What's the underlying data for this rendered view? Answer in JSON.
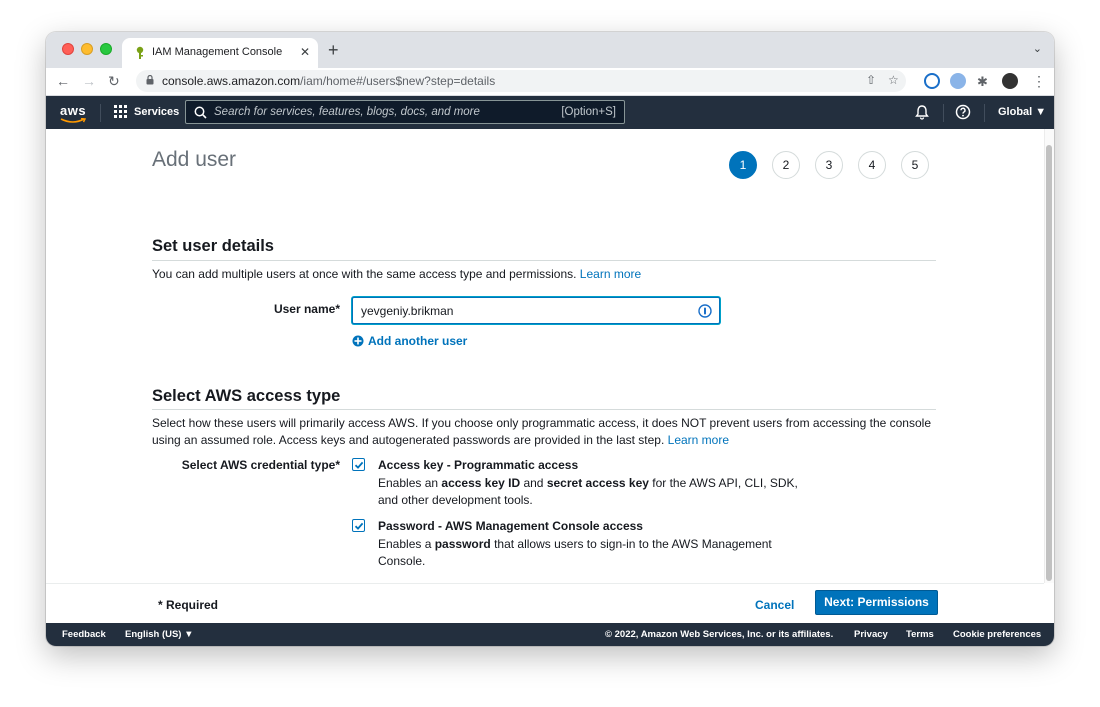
{
  "browser": {
    "tab_title": "IAM Management Console",
    "url_host": "console.aws.amazon.com",
    "url_path": "/iam/home#/users$new?step=details"
  },
  "aws_nav": {
    "logo": "aws",
    "services_label": "Services",
    "search_placeholder": "Search for services, features, blogs, docs, and more",
    "search_shortcut": "[Option+S]",
    "region_label": "Global ▼"
  },
  "page": {
    "title": "Add user",
    "steps": [
      "1",
      "2",
      "3",
      "4",
      "5"
    ],
    "active_step": 1
  },
  "user_details": {
    "heading": "Set user details",
    "description": "You can add multiple users at once with the same access type and permissions.",
    "learn_more": "Learn more",
    "username_label": "User name*",
    "username_value": "yevgeniy.brikman",
    "add_another": "Add another user"
  },
  "access_type": {
    "heading": "Select AWS access type",
    "description": "Select how these users will primarily access AWS. If you choose only programmatic access, it does NOT prevent users from accessing the console using an assumed role. Access keys and autogenerated passwords are provided in the last step.",
    "learn_more": "Learn more",
    "credential_label": "Select AWS credential type*",
    "options": [
      {
        "title": "Access key - Programmatic access",
        "desc_parts": [
          "Enables an ",
          "access key ID",
          " and ",
          "secret access key",
          " for the AWS API, CLI, SDK, and other development tools."
        ],
        "checked": true
      },
      {
        "title": "Password - AWS Management Console access",
        "desc_parts": [
          "Enables a ",
          "password",
          " that allows users to sign-in to the AWS Management Console."
        ],
        "checked": true
      }
    ]
  },
  "actions": {
    "required_note": "* Required",
    "cancel_label": "Cancel",
    "next_label": "Next: Permissions"
  },
  "footer": {
    "feedback": "Feedback",
    "language": "English (US) ▼",
    "copyright": "© 2022, Amazon Web Services, Inc. or its affiliates.",
    "privacy": "Privacy",
    "terms": "Terms",
    "cookies": "Cookie preferences"
  },
  "colors": {
    "aws_nav": "#232f3e",
    "primary": "#0073bb",
    "aws_orange": "#ff9900"
  }
}
